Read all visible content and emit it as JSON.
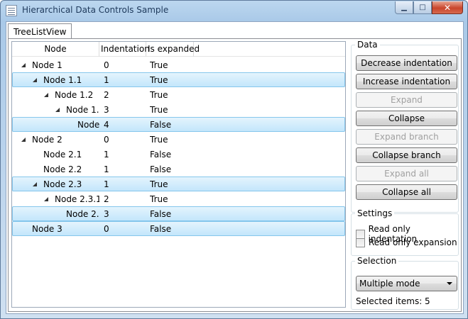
{
  "window": {
    "title": "Hierarchical Data Controls Sample",
    "caption_buttons": {
      "minimize": "▁",
      "maximize": "□",
      "close": "✕"
    }
  },
  "tabs": [
    {
      "label": "TreeListView",
      "selected": true
    }
  ],
  "treelist": {
    "columns": [
      "Node",
      "Indentation",
      "Is expanded"
    ],
    "rows": [
      {
        "node": "Node 1",
        "indentation": "0",
        "expanded": "True",
        "level": 0,
        "has_children": true,
        "selected": false
      },
      {
        "node": "Node 1.1",
        "indentation": "1",
        "expanded": "True",
        "level": 1,
        "has_children": true,
        "selected": true
      },
      {
        "node": "Node 1.2",
        "indentation": "2",
        "expanded": "True",
        "level": 2,
        "has_children": true,
        "selected": false
      },
      {
        "node": "Node 1.",
        "indentation": "3",
        "expanded": "True",
        "level": 3,
        "has_children": true,
        "selected": false
      },
      {
        "node": "Node",
        "indentation": "4",
        "expanded": "False",
        "level": 4,
        "has_children": false,
        "selected": true
      },
      {
        "node": "Node 2",
        "indentation": "0",
        "expanded": "True",
        "level": 0,
        "has_children": true,
        "selected": false
      },
      {
        "node": "Node 2.1",
        "indentation": "1",
        "expanded": "False",
        "level": 1,
        "has_children": false,
        "selected": false
      },
      {
        "node": "Node 2.2",
        "indentation": "1",
        "expanded": "False",
        "level": 1,
        "has_children": false,
        "selected": false
      },
      {
        "node": "Node 2.3",
        "indentation": "1",
        "expanded": "True",
        "level": 1,
        "has_children": true,
        "selected": true
      },
      {
        "node": "Node 2.3.1",
        "indentation": "2",
        "expanded": "True",
        "level": 2,
        "has_children": true,
        "selected": false
      },
      {
        "node": "Node 2.",
        "indentation": "3",
        "expanded": "False",
        "level": 3,
        "has_children": false,
        "selected": true
      },
      {
        "node": "Node 3",
        "indentation": "0",
        "expanded": "False",
        "level": 0,
        "has_children": false,
        "selected": true
      }
    ]
  },
  "data_panel": {
    "title": "Data",
    "buttons": [
      {
        "label": "Decrease indentation",
        "enabled": true
      },
      {
        "label": "Increase indentation",
        "enabled": true
      },
      {
        "label": "Expand",
        "enabled": false
      },
      {
        "label": "Collapse",
        "enabled": true
      },
      {
        "label": "Expand branch",
        "enabled": false
      },
      {
        "label": "Collapse branch",
        "enabled": true
      },
      {
        "label": "Expand all",
        "enabled": false
      },
      {
        "label": "Collapse all",
        "enabled": true
      }
    ]
  },
  "settings_panel": {
    "title": "Settings",
    "checkboxes": [
      {
        "label": "Read only indentation",
        "checked": false
      },
      {
        "label": "Read only expansion",
        "checked": false
      }
    ]
  },
  "selection_panel": {
    "title": "Selection",
    "mode_value": "Multiple mode",
    "selected_items": "Selected items: 5"
  }
}
